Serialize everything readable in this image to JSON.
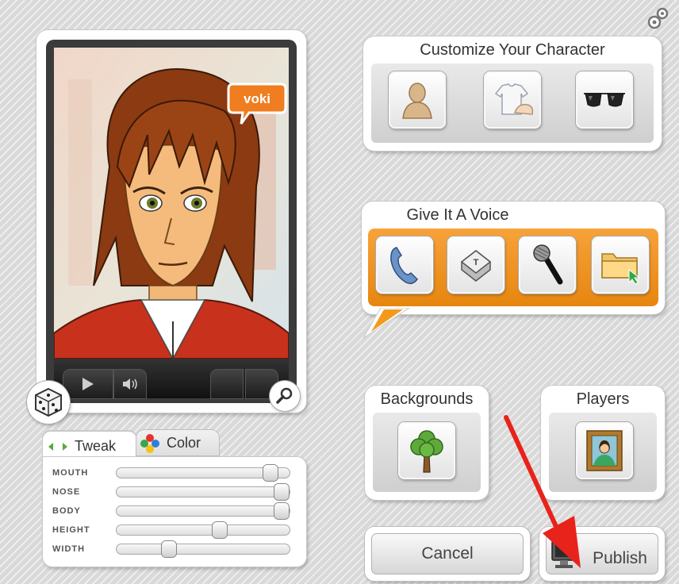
{
  "character": {
    "brand_badge": "voki",
    "controls": {
      "play_icon": "play-icon",
      "volume_icon": "volume-icon",
      "random_icon": "dice-icon",
      "zoom_icon": "magnifier-icon"
    }
  },
  "corner_icon": "gear-circles-icon",
  "customize": {
    "title": "Customize Your Character",
    "buttons": [
      {
        "icon": "head-silhouette-icon"
      },
      {
        "icon": "clothing-icon"
      },
      {
        "icon": "sunglasses-icon"
      }
    ]
  },
  "voice": {
    "title": "Give It A Voice",
    "buttons": [
      {
        "icon": "phone-icon"
      },
      {
        "icon": "keyboard-key-icon",
        "key_letter": "T"
      },
      {
        "icon": "microphone-icon"
      },
      {
        "icon": "folder-icon"
      }
    ],
    "accent_color": "#f39a1e"
  },
  "backgrounds": {
    "title": "Backgrounds",
    "icon": "tree-icon"
  },
  "players": {
    "title": "Players",
    "icon": "framed-portrait-icon"
  },
  "tweak": {
    "tabs": [
      {
        "label": "Tweak",
        "active": true
      },
      {
        "label": "Color",
        "active": false
      }
    ],
    "sliders": [
      {
        "label": "MOUTH",
        "value": 0.9
      },
      {
        "label": "NOSE",
        "value": 0.96
      },
      {
        "label": "BODY",
        "value": 0.96
      },
      {
        "label": "HEIGHT",
        "value": 0.6
      },
      {
        "label": "WIDTH",
        "value": 0.3
      }
    ]
  },
  "actions": {
    "cancel_label": "Cancel",
    "publish_label": "Publish"
  },
  "annotation": {
    "arrow_color": "#e8231b"
  }
}
